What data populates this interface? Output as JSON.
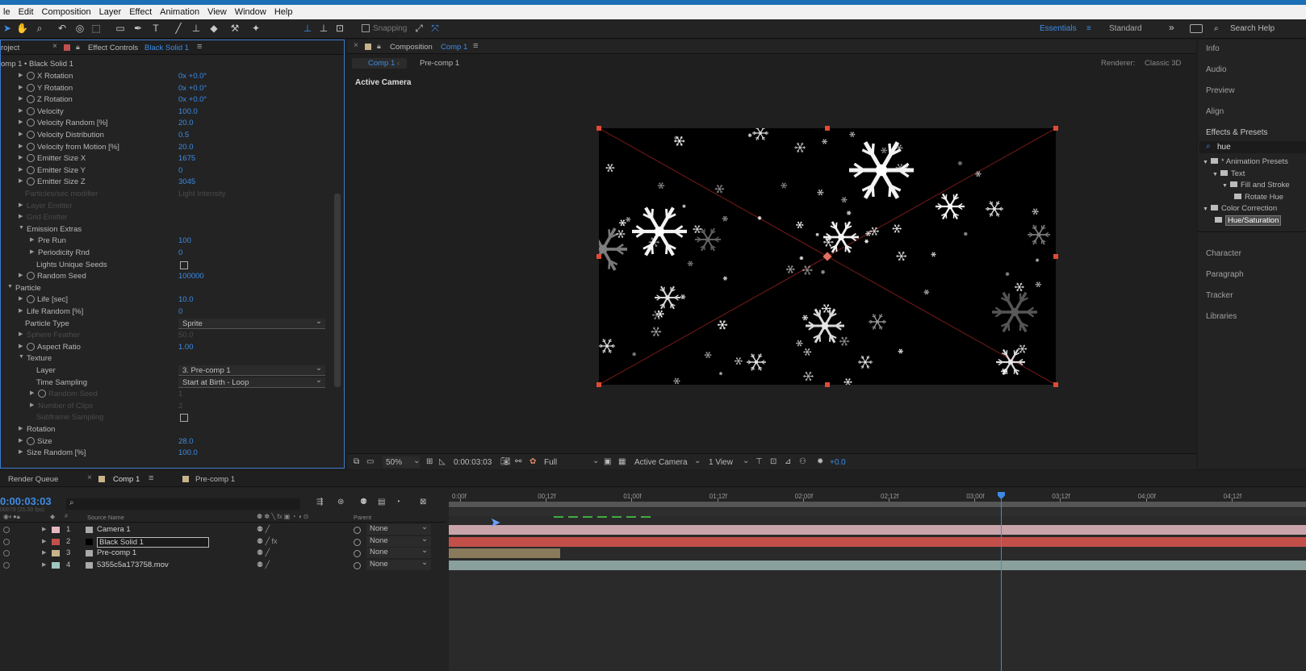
{
  "menu": [
    "le",
    "Edit",
    "Composition",
    "Layer",
    "Effect",
    "Animation",
    "View",
    "Window",
    "Help"
  ],
  "toolbar": {
    "snapping_label": "Snapping",
    "workspace_active": "Essentials",
    "workspace_other": "Standard",
    "search_help": "Search Help"
  },
  "effect_panel": {
    "project_tab": "roject",
    "tab_prefix": "Effect Controls",
    "tab_layer": "Black Solid 1",
    "breadcrumb": "omp 1 • Black Solid 1",
    "rows": [
      {
        "label": "X Rotation",
        "value": "0x +0.0°",
        "tri": true,
        "stop": true,
        "indent": 22
      },
      {
        "label": "Y Rotation",
        "value": "0x +0.0°",
        "tri": true,
        "stop": true,
        "indent": 22
      },
      {
        "label": "Z Rotation",
        "value": "0x +0.0°",
        "tri": true,
        "stop": true,
        "indent": 22
      },
      {
        "label": "Velocity",
        "value": "100.0",
        "tri": true,
        "stop": true,
        "indent": 22
      },
      {
        "label": "Velocity Random [%]",
        "value": "20.0",
        "tri": true,
        "stop": true,
        "indent": 22
      },
      {
        "label": "Velocity Distribution",
        "value": "0.5",
        "tri": true,
        "stop": true,
        "indent": 22
      },
      {
        "label": "Velocity from Motion [%]",
        "value": "20.0",
        "tri": true,
        "stop": true,
        "indent": 22
      },
      {
        "label": "Emitter Size X",
        "value": "1675",
        "tri": true,
        "stop": true,
        "indent": 22
      },
      {
        "label": "Emitter Size Y",
        "value": "0",
        "tri": true,
        "stop": true,
        "indent": 22
      },
      {
        "label": "Emitter Size Z",
        "value": "3045",
        "tri": true,
        "stop": true,
        "indent": 22
      },
      {
        "label": "Particles/sec modifier",
        "value": "Light Intensity",
        "dim": true,
        "indent": 30
      },
      {
        "label": "Layer Emitter",
        "value": "",
        "dim": true,
        "tri": true,
        "indent": 22
      },
      {
        "label": "Grid Emitter",
        "value": "",
        "dim": true,
        "tri": true,
        "indent": 22
      },
      {
        "label": "Emission Extras",
        "value": "",
        "open": true,
        "indent": 22
      },
      {
        "label": "Pre Run",
        "value": "100",
        "tri": true,
        "indent": 36
      },
      {
        "label": "Periodicity Rnd",
        "value": "0",
        "tri": true,
        "indent": 36
      },
      {
        "label": "Lights Unique Seeds",
        "value": "",
        "checkbox": true,
        "indent": 44
      },
      {
        "label": "Random Seed",
        "value": "100000",
        "tri": true,
        "stop": true,
        "indent": 22
      },
      {
        "label": "Particle",
        "value": "",
        "open": true,
        "indent": 8
      },
      {
        "label": "Life [sec]",
        "value": "10.0",
        "tri": true,
        "stop": true,
        "indent": 22
      },
      {
        "label": "Life Random [%]",
        "value": "0",
        "tri": true,
        "indent": 22
      },
      {
        "label": "Particle Type",
        "value": "Sprite",
        "dropdown": true,
        "indent": 30
      },
      {
        "label": "Sphere Feather",
        "value": "50.0",
        "dim": true,
        "tri": true,
        "indent": 22
      },
      {
        "label": "Aspect Ratio",
        "value": "1.00",
        "tri": true,
        "stop": true,
        "indent": 22
      },
      {
        "label": "Texture",
        "value": "",
        "open": true,
        "indent": 22
      },
      {
        "label": "Layer",
        "value": "3. Pre-comp 1",
        "dropdown": true,
        "indent": 44
      },
      {
        "label": "Time Sampling",
        "value": "Start at Birth - Loop",
        "dropdown": true,
        "indent": 44
      },
      {
        "label": "Random Seed",
        "value": "1",
        "dim": true,
        "tri": true,
        "stop": true,
        "indent": 36
      },
      {
        "label": "Number of Clips",
        "value": "2",
        "dim": true,
        "tri": true,
        "indent": 36
      },
      {
        "label": "Subframe Sampling",
        "value": "",
        "dim": true,
        "checkbox": true,
        "indent": 44
      },
      {
        "label": "Rotation",
        "value": "",
        "tri": true,
        "indent": 22
      },
      {
        "label": "Size",
        "value": "28.0",
        "tri": true,
        "stop": true,
        "indent": 22
      },
      {
        "label": "Size Random [%]",
        "value": "100.0",
        "tri": true,
        "indent": 22
      }
    ]
  },
  "comp_panel": {
    "tab_prefix": "Composition",
    "tab_name": "Comp 1",
    "sub_tabs": [
      "Comp 1",
      "Pre-comp 1"
    ],
    "renderer_label": "Renderer:",
    "renderer_value": "Classic 3D",
    "view_label": "Active Camera",
    "footer": {
      "zoom": "50%",
      "timecode": "0:00:03:03",
      "resolution": "Full",
      "camera": "Active Camera",
      "views": "1 View",
      "exposure": "+0.0"
    }
  },
  "right_panel": {
    "items_top": [
      "Info",
      "Audio",
      "Preview",
      "Align",
      "Effects & Presets"
    ],
    "search_value": "hue",
    "tree": [
      {
        "label": "* Animation Presets",
        "level": 0
      },
      {
        "label": "Text",
        "level": 1
      },
      {
        "label": "Fill and Stroke",
        "level": 2
      },
      {
        "label": "Rotate Hue",
        "level": 3
      },
      {
        "label": "Color Correction",
        "level": 0
      },
      {
        "label": "Hue/Saturation",
        "level": 1,
        "selected": true
      }
    ],
    "items_bottom": [
      "Character",
      "Paragraph",
      "Tracker",
      "Libraries"
    ]
  },
  "timeline": {
    "tabs": [
      "Render Queue",
      "Comp 1",
      "Pre-comp 1"
    ],
    "timecode": "0:00:03:03",
    "timecode_sub": "00079 (25.00 fps)",
    "col_source": "Source Name",
    "col_parent": "Parent",
    "col_num": "#",
    "ruler": [
      "0:00f",
      "00:12f",
      "01:00f",
      "01:12f",
      "02:00f",
      "02:12f",
      "03:00f",
      "03:12f",
      "04:00f",
      "04:12f"
    ],
    "layers": [
      {
        "num": "1",
        "name": "Camera 1",
        "parent": "None",
        "label_color": "#e6b8c0",
        "bar_color": "#c9a5ab",
        "bar_end": 1.0
      },
      {
        "num": "2",
        "name": "Black Solid 1",
        "parent": "None",
        "label_color": "#c0504d",
        "bar_color": "#c24f4a",
        "bar_end": 1.0,
        "selected": true
      },
      {
        "num": "3",
        "name": "Pre-comp 1",
        "parent": "None",
        "label_color": "#c8b48a",
        "bar_color": "#8a7a5c",
        "bar_end": 0.13
      },
      {
        "num": "4",
        "name": "5355c5a173758.mov",
        "parent": "None",
        "label_color": "#9fc7c0",
        "bar_color": "#8aa09c",
        "bar_end": 1.0
      }
    ],
    "playhead_fraction": 0.644
  }
}
